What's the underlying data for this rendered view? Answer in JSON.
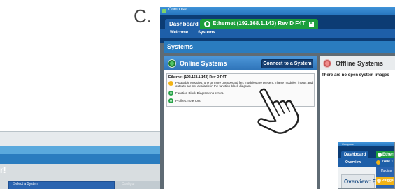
{
  "step_label": "C.",
  "background_window": {
    "partial_heading": "r!",
    "panel_title": "Select a System",
    "side_text": "Configur"
  },
  "window": {
    "title": "Compuser",
    "tabs": {
      "dashboard": "Dashboard",
      "ethernet": "Ethernet (192.168.1.143) Rev D F4T"
    },
    "subnav": {
      "welcome": "Welcome",
      "systems": "Systems"
    },
    "section_title": "Systems",
    "online": {
      "heading": "Online Systems",
      "connect_button": "Connect to a System",
      "system": {
        "title": "Ethernet (192.168.1.143) Rev D F4T",
        "messages": [
          {
            "status": "warning",
            "line1": "Pluggable Modules: one or more unexpected flex modules are present. These modules' inputs and",
            "line2": "outputs are not available in the function block diagram"
          },
          {
            "status": "ok",
            "line1": "Function Block Diagram: no errors.",
            "line2": ""
          },
          {
            "status": "ok",
            "line1": "Profiles: no errors.",
            "line2": ""
          }
        ]
      }
    },
    "offline": {
      "heading": "Offline Systems",
      "empty_message": "There are no open system images"
    }
  },
  "inset_window": {
    "title": "Compuser",
    "dashboard_tab": "Dashboard",
    "ethernet_tab": "Ethern",
    "overview_tab": "Overview",
    "zone_tab": "Zone 1",
    "overview_heading": "Overview: E",
    "menu_item_device": "Device",
    "menu_item_pluggable": "Plugga"
  },
  "colors": {
    "titlebar": "#2573bd",
    "menubar": "#0c3c74",
    "tab_blue": "#1e5fa8",
    "tab_green": "#1c9e3c",
    "header_blue": "#2a7cbf",
    "warning": "#f2b315",
    "ok": "#2aa24a"
  },
  "icons": {
    "online_heading": "globe-online-icon",
    "offline_heading": "globe-offline-icon",
    "ethernet_tab": "ethernet-status-icon",
    "cursor": "hand-pointer-icon"
  }
}
